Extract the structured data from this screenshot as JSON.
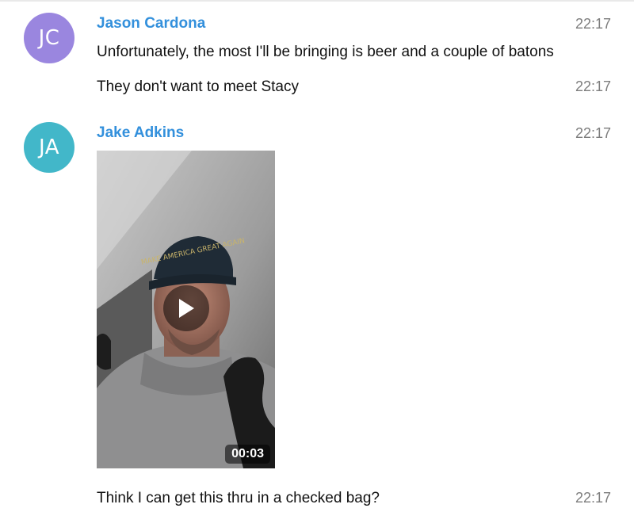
{
  "colors": {
    "sender_name": "#3390dc",
    "avatar_jc": "#9a86df",
    "avatar_ja": "#42b7c9",
    "timestamp": "#7d7d7d"
  },
  "messages": [
    {
      "avatar_initials": "JC",
      "sender": "Jason Cardona",
      "lines": [
        {
          "text": "Unfortunately, the most I'll be bringing is beer and a couple of batons",
          "time": "22:17"
        },
        {
          "text": "They don't want to meet Stacy",
          "time": "22:17"
        }
      ]
    },
    {
      "avatar_initials": "JA",
      "sender": "Jake Adkins",
      "time": "22:17",
      "video": {
        "duration": "00:03",
        "play_icon": "play-icon",
        "cap_text": "MAKE AMERICA GREAT AGAIN"
      },
      "lines": [
        {
          "text": "Think I can get this thru in a checked bag?",
          "time": "22:17"
        }
      ]
    }
  ]
}
